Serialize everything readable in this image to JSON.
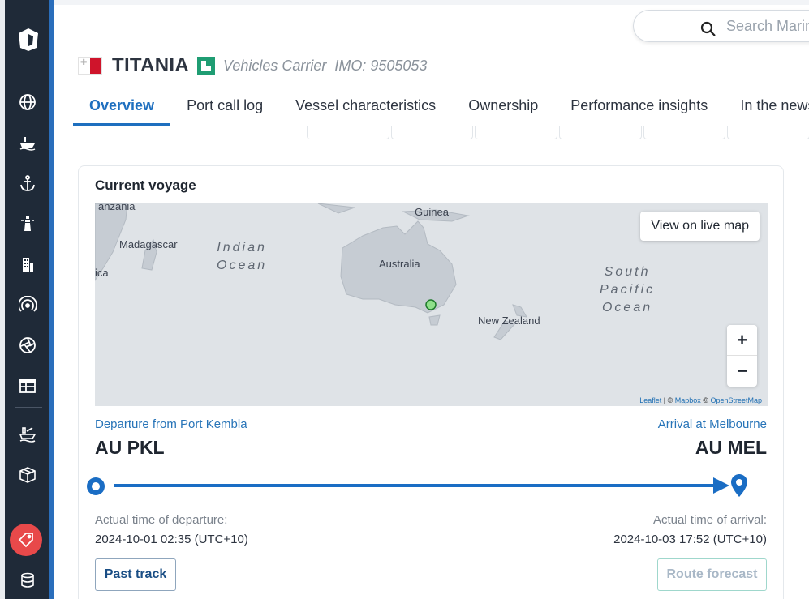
{
  "sidebar": {
    "logo": "marinetraffic-logo-icon",
    "items": [
      {
        "icon": "globe-icon"
      },
      {
        "icon": "ship-icon"
      },
      {
        "icon": "anchor-icon"
      },
      {
        "icon": "lighthouse-icon"
      },
      {
        "icon": "building-icon"
      },
      {
        "icon": "signal-icon"
      },
      {
        "icon": "aperture-icon"
      },
      {
        "icon": "table-icon"
      },
      {
        "icon": "ship-cargo-icon"
      },
      {
        "icon": "box-icon"
      },
      {
        "icon": "tag-icon"
      },
      {
        "icon": "database-icon"
      }
    ]
  },
  "search": {
    "placeholder": "Search MarineTraffic"
  },
  "vessel": {
    "name": "TITANIA",
    "type": "Vehicles Carrier",
    "imo": "IMO: 9505053",
    "flag": "Malta"
  },
  "tabs": [
    {
      "label": "Overview",
      "active": true
    },
    {
      "label": "Port call log"
    },
    {
      "label": "Vessel characteristics"
    },
    {
      "label": "Ownership"
    },
    {
      "label": "Performance insights"
    },
    {
      "label": "In the news"
    }
  ],
  "voyage": {
    "title": "Current voyage",
    "map": {
      "labels": {
        "tanzania": "anzania",
        "madagascar": "Madagascar",
        "africa": "ica",
        "guinea": "Guinea",
        "australia": "Australia",
        "new_zealand": "New Zealand",
        "indian_ocean_1": "Indian",
        "indian_ocean_2": "Ocean",
        "pacific_1": "South",
        "pacific_2": "Pacific",
        "pacific_3": "Ocean"
      },
      "live_button": "View on live map",
      "zoom_in": "+",
      "zoom_out": "−",
      "attribution": {
        "leaflet": "Leaflet",
        "sep1": " | © ",
        "mapbox": "Mapbox",
        "sep2": " © ",
        "osm": "OpenStreetMap"
      }
    },
    "departure_label": "Departure from Port Kembla",
    "arrival_label": "Arrival at Melbourne",
    "departure_code": "AU PKL",
    "arrival_code": "AU MEL",
    "atd_label": "Actual time of departure:",
    "ata_label": "Actual time of arrival:",
    "atd_value": "2024-10-01 02:35 (UTC+10)",
    "ata_value": "2024-10-03 17:52 (UTC+10)",
    "past_track_button": "Past track",
    "route_forecast_button": "Route forecast"
  },
  "colors": {
    "sidebar": "#1f2a38",
    "accent": "#1e6fbf",
    "vessel_badge": "#1f9d73",
    "alert": "#e8494a"
  }
}
